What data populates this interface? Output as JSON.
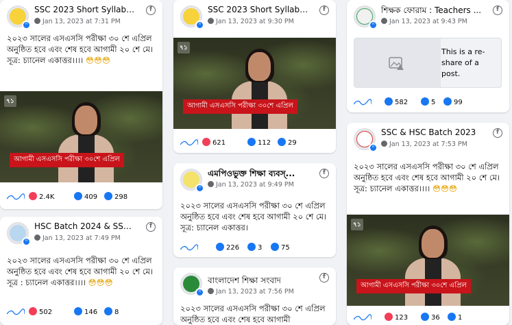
{
  "posts": [
    {
      "name": "SSC 2023 Short Syllabus ...",
      "timestamp": "Jan 13, 2023 at 7:31 PM",
      "text": "২০২৩ সালের এসএসসি পরীক্ষা ৩০ শে এপ্রিল অনুষ্ঠিত হবে এবং শেষ হবে আগামী ২০ শে মে। সূত্র: চ্যানেল একাত্তর।।।।",
      "emoji": "😳😳😳",
      "video_logo": "৭১",
      "lower_third": "আগামী এসএসসি পরীক্ষা ৩০শে এপ্রিল",
      "reactions": "2.4K",
      "comments": "409",
      "shares": "298"
    },
    {
      "name": "HSC Batch 2024 & SSC'23 ...",
      "timestamp": "Jan 13, 2023 at 7:49 PM",
      "text": "২০২৩ সালের এসএসসি পরীক্ষা ৩০ শে এপ্রিল অনুষ্ঠিত হবে এবং শেষ হবে আগামী ২০ শে মে। সূত্র : চ্যানেল একাত্তর।।।।",
      "emoji": "😳😳😳",
      "reactions": "502",
      "comments": "146",
      "shares": "8"
    },
    {
      "name": "SSC 2023 Short Syllabus ...",
      "timestamp": "Jan 13, 2023 at 9:30 PM",
      "video_logo": "৭১",
      "lower_third": "আগামী এসএসসি পরীক্ষা ৩০শে এপ্রিল",
      "reactions": "621",
      "comments": "112",
      "shares": "29"
    },
    {
      "name": "এমপিওভুক্ত শিক্ষা ব্যবস্...",
      "timestamp": "Jan 13, 2023 at 9:49 PM",
      "text": "২০২৩ সালের এসএসসি পরীক্ষা ৩০ শে এপ্রিল অনুষ্ঠিত হবে এবং শেষ হবে আগামী ২০ শে মে। সূত্র: চ্যানেল একাত্তর।",
      "reactions": "226",
      "comments": "3",
      "shares": "75"
    },
    {
      "name": "বাংলাদেশ শিক্ষা সংবাদ",
      "timestamp": "Jan 13, 2023 at 7:56 PM",
      "text": "২০২৩ সালের এসএসসি পরীক্ষা ৩০ শে এপ্রিল অনুষ্ঠিত হবে এবং শেষ হবে আগামী"
    },
    {
      "name": "শিক্ষক ফোরাম : Teachers ...",
      "timestamp": "Jan 13, 2023 at 9:43 PM",
      "share_text": "This is a re-share of a post.",
      "reactions": "582",
      "comments": "5",
      "shares": "99"
    },
    {
      "name": "SSC & HSC Batch 2023",
      "timestamp": "Jan 13, 2023 at 7:53 PM",
      "text": "২০২৩ সালের এসএসসি পরীক্ষা ৩০ শে এপ্রিল অনুষ্ঠিত হবে এবং শেষ হবে আগামী ২০ শে মে। সূত্র: চ্যানেল একাত্তর।।।।",
      "emoji": "😳😳😳",
      "video_logo": "৭১",
      "lower_third": "আগামী এসএসসি পরীক্ষা ৩০শে এপ্রিল",
      "reactions": "123",
      "comments": "36",
      "shares": "1"
    }
  ],
  "colors": {
    "background": "#f0f2f5",
    "brand_blue": "#1877f2",
    "news_red": "#c8141a",
    "muted_text": "#65676b"
  },
  "icons": {
    "platform": "facebook-icon",
    "audience": "globe-icon",
    "reactions": "reaction-icons",
    "comments": "comment-icon",
    "shares": "share-icon",
    "trend": "sparkline-icon",
    "broken_image": "broken-image-icon"
  }
}
